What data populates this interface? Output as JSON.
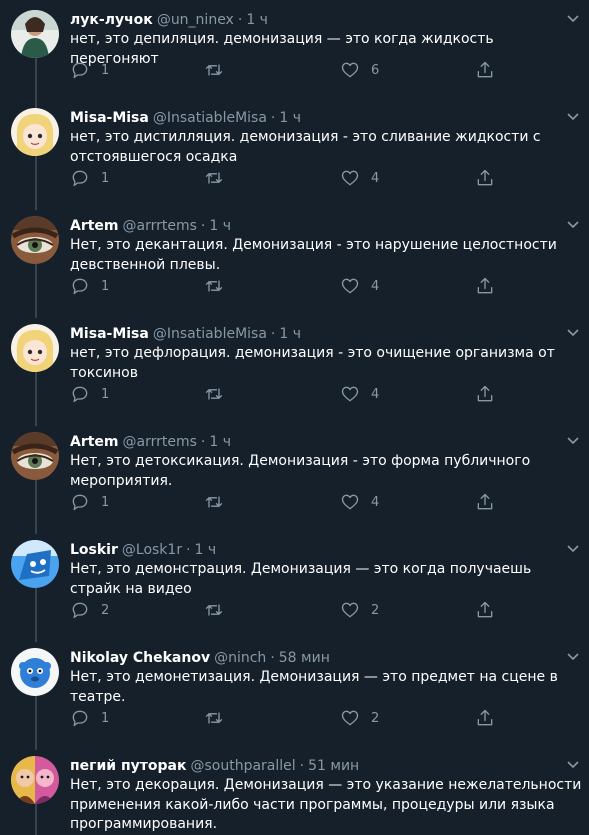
{
  "tweets": [
    {
      "name": "лук-лучок",
      "handle": "@un_ninex",
      "time": "1 ч",
      "text": "нет, это депиляция. демонизация — это когда жидкость перегоняют",
      "replies": "1",
      "retweets": "",
      "likes": "6",
      "avatar_color": "#2b5a48"
    },
    {
      "name": "Misa-Misa",
      "handle": "@InsatiableMisa",
      "time": "1 ч",
      "text": "нет, это дистилляция. демонизация - это сливание жидкости с отстоявшегося осадка",
      "replies": "1",
      "retweets": "",
      "likes": "4",
      "avatar_color": "#f1d37a"
    },
    {
      "name": "Artem",
      "handle": "@arrrtems",
      "time": "1 ч",
      "text": "Нет, это декантация. Демонизация - это нарушение целостности девственной плевы.",
      "replies": "1",
      "retweets": "",
      "likes": "4",
      "avatar_color": "#6a4a35"
    },
    {
      "name": "Misa-Misa",
      "handle": "@InsatiableMisa",
      "time": "1 ч",
      "text": "нет, это дефлорация. демонизация - это очищение организма от токсинов",
      "replies": "1",
      "retweets": "",
      "likes": "4",
      "avatar_color": "#f1d37a"
    },
    {
      "name": "Artem",
      "handle": "@arrrtems",
      "time": "1 ч",
      "text": "Нет, это детоксикация. Демонизация - это форма публичного мероприятия.",
      "replies": "1",
      "retweets": "",
      "likes": "4",
      "avatar_color": "#6a4a35"
    },
    {
      "name": "Loskir",
      "handle": "@Losk1r",
      "time": "1 ч",
      "text": "Нет, это демонстрация. Демонизация — это когда получаешь страйк на видео",
      "replies": "2",
      "retweets": "",
      "likes": "2",
      "avatar_color": "#2f8fe0"
    },
    {
      "name": "Nikolay Chekanov",
      "handle": "@ninch",
      "time": "58 мин",
      "text": "Нет, это демонетизация. Демонизация — это предмет на сцене в театре.",
      "replies": "1",
      "retweets": "",
      "likes": "2",
      "avatar_color": "#f4f6f8"
    },
    {
      "name": "пегий путорак",
      "handle": "@southparallel",
      "time": "51 мин",
      "text": "Нет, это декорация. Демонизация — это указание нежелательности применения какой-либо части программы, процедуры или языка программирования.",
      "replies": "",
      "retweets": "",
      "likes": "",
      "avatar_color": "#d35a9c"
    }
  ]
}
